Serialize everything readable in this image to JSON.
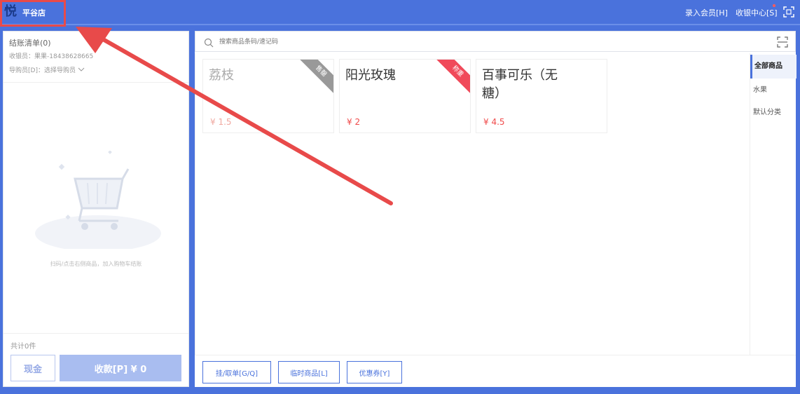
{
  "header": {
    "logo_char": "悦",
    "store_name": "平谷店",
    "register_member": "录入会员[H]",
    "cashier_center": "收银中心[S]"
  },
  "cart": {
    "title": "结账清单(0)",
    "cashier_label": "收银员：果果-18438628665",
    "guide_label": "导购员[D]：选择导购员",
    "empty_hint": "扫码/点击右侧商品，加入购物车结账",
    "total_count": "共计0件",
    "cash_button": "现金",
    "pay_button": "收款[P] ¥ 0"
  },
  "search": {
    "placeholder": "搜索商品条码/速记码"
  },
  "products": [
    {
      "name": "荔枝",
      "price": "¥ 1.5",
      "ribbon": "售罄",
      "ribbon_color": "#999999",
      "disabled": true
    },
    {
      "name": "阳光玫瑰",
      "price": "¥ 2",
      "ribbon": "称重",
      "ribbon_color": "#f04a5a",
      "disabled": false
    },
    {
      "name": "百事可乐（无糖）",
      "price": "¥ 4.5",
      "ribbon": "",
      "disabled": false
    }
  ],
  "categories": [
    {
      "label": "全部商品",
      "active": true
    },
    {
      "label": "水果",
      "active": false
    },
    {
      "label": "默认分类",
      "active": false
    }
  ],
  "bottom_buttons": {
    "hang_order": "挂/取单[G/Q]",
    "temp_product": "临时商品[L]",
    "coupon": "优惠券[Y]"
  },
  "colors": {
    "brand": "#4a72dc",
    "price": "#f04a4a",
    "annotation": "#e84a4a"
  }
}
